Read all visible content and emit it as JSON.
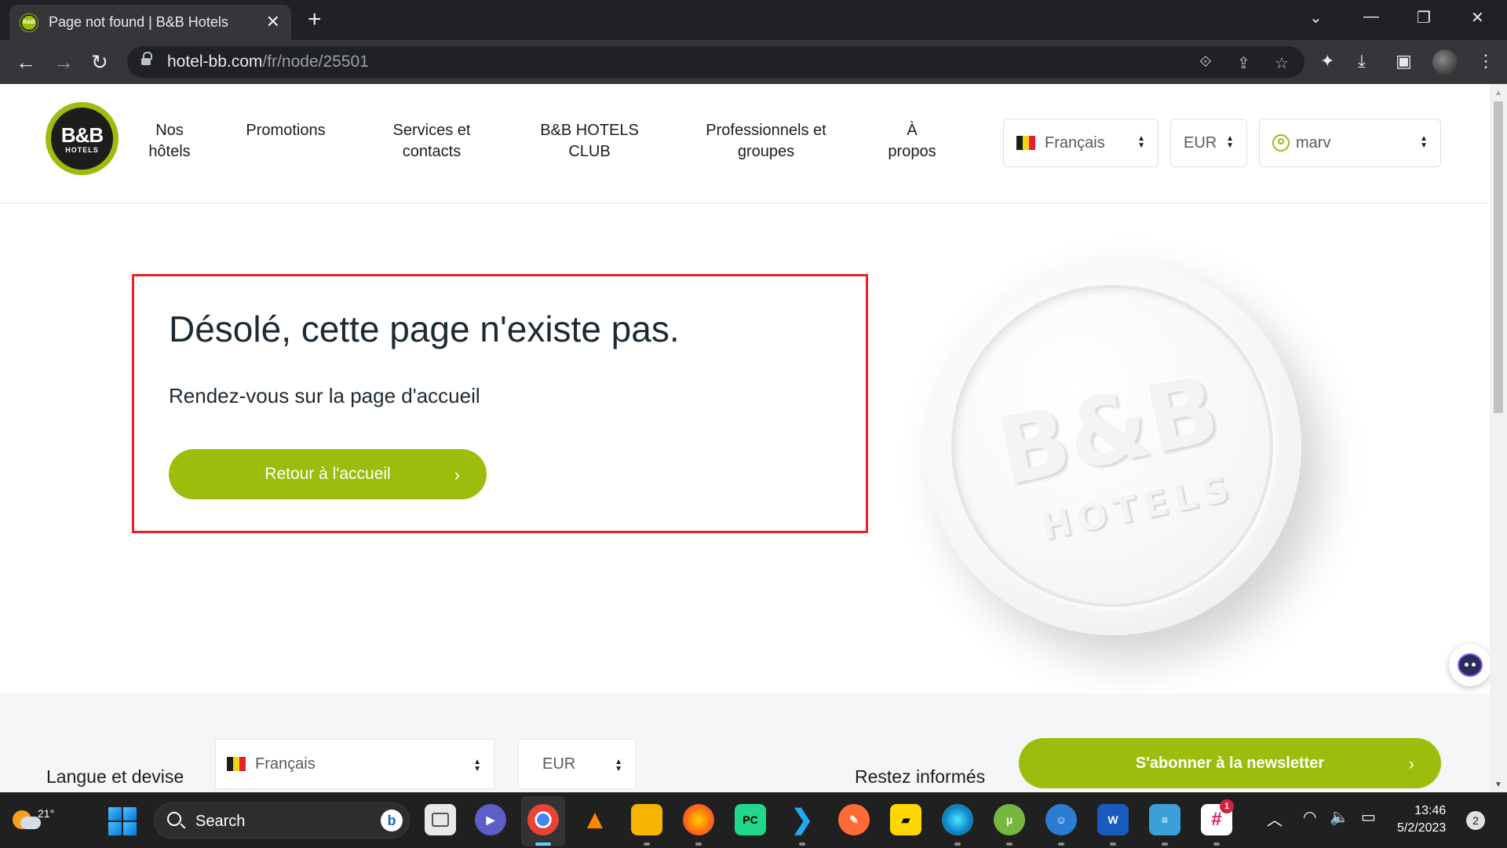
{
  "browser": {
    "tab_title": "Page not found | B&B Hotels",
    "tab_close": "✕",
    "new_tab": "+",
    "url_host": "hotel-bb.com",
    "url_path": "/fr/node/25501",
    "window_controls": {
      "dropdown": "⌄",
      "minimize": "—",
      "restore": "❐",
      "close": "✕"
    }
  },
  "header": {
    "logo_main": "B&B",
    "logo_sub": "HOTELS",
    "nav": [
      {
        "line1": "Nos",
        "line2": "hôtels"
      },
      {
        "line1": "Promotions",
        "line2": ""
      },
      {
        "line1": "Services et",
        "line2": "contacts"
      },
      {
        "line1": "B&B HOTELS",
        "line2": "CLUB"
      },
      {
        "line1": "Professionnels et",
        "line2": "groupes"
      },
      {
        "line1": "À",
        "line2": "propos"
      }
    ],
    "language": "Français",
    "currency": "EUR",
    "user": "marv"
  },
  "error": {
    "title": "Désolé, cette page n'existe pas.",
    "subtitle": "Rendez-vous sur la page d'accueil",
    "button": "Retour à l'accueil"
  },
  "coin": {
    "main": "B&B",
    "sub": "HOTELS"
  },
  "footer": {
    "language_label": "Langue et devise",
    "language": "Français",
    "currency": "EUR",
    "newsletter_label": "Restez informés",
    "newsletter_button": "S'abonner à la newsletter"
  },
  "taskbar": {
    "temperature": "21°",
    "search": "Search",
    "time": "13:46",
    "date": "5/2/2023",
    "notifications": "2",
    "slack_badge": "1"
  },
  "colors": {
    "brand_green": "#9bbd0b",
    "highlight_red": "#e3222a",
    "text_dark": "#1d2a33"
  }
}
